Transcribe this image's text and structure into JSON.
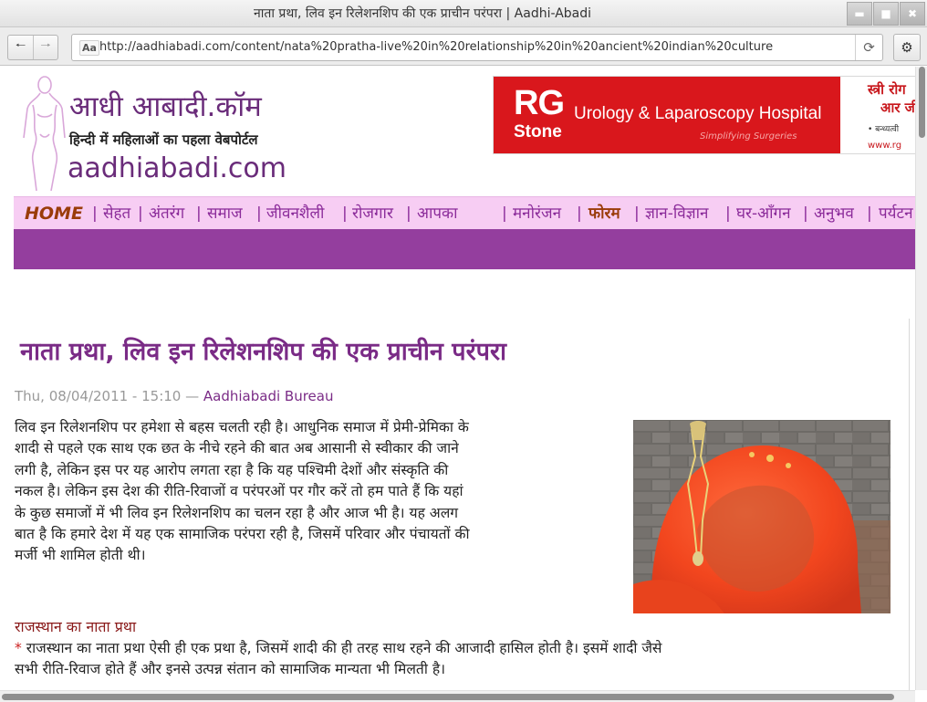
{
  "window": {
    "title": "नाता प्रथा, लिव इन रिलेशनशिप की एक प्राचीन परंपरा | Aadhi-Abadi"
  },
  "browser": {
    "url": "http://aadhiabadi.com/content/nata%20pratha-live%20in%20relationship%20in%20ancient%20indian%20culture",
    "site_icon_text": "Aa"
  },
  "header": {
    "logo_hindi": "आधी आबादी.कॉम",
    "logo_tagline": "हिन्दी में महिलाओं का पहला वेबपोर्टल",
    "logo_english": "aadhiabadi.com"
  },
  "ad": {
    "brand": "RG",
    "brand_sub": "Stone",
    "hospital": "Urology & Laparoscopy Hospital",
    "tagline": "Simplifying Surgeries",
    "right_line1": "स्त्री रोग",
    "right_line2": "आर जी",
    "right_line3": "• बन्ध्यत्वी",
    "right_line4": "www.rg"
  },
  "nav": {
    "items": [
      {
        "label": "HOME"
      },
      {
        "label": "सेहत"
      },
      {
        "label": "अंतरंग"
      },
      {
        "label": "समाज"
      },
      {
        "label": "जीवनशैली"
      },
      {
        "label": "रोजगार"
      },
      {
        "label": "आपका"
      },
      {
        "label": "मनोरंजन"
      },
      {
        "label": "फोरम"
      },
      {
        "label": "ज्ञान-विज्ञान"
      },
      {
        "label": "घर-आँगन"
      },
      {
        "label": "अनुभव"
      },
      {
        "label": "पर्यटन"
      }
    ],
    "separator": "|"
  },
  "article": {
    "title": "नाता प्रथा, लिव इन रिलेशनशिप की एक प्राचीन परंपरा",
    "date": "Thu, 08/04/2011 - 15:10",
    "dash": "—",
    "author": "Aadhiabadi Bureau",
    "paragraph1_lines": [
      "लिव इन रिलेशनशिप पर हमेशा से बहस चलती रही है। आधुनिक समाज में प्रेमी-प्रेमिका के",
      "शादी से पहले एक साथ एक छत के नीचे रहने की बात अब आसानी से स्वीकार की जाने",
      "लगी है, लेकिन इस पर यह आरोप लगता रहा है कि यह पश्चिमी देशों और संस्कृति की",
      "नकल है। लेकिन इस देश की रीति-रिवाजों व परंपरओं पर गौर करें तो हम पाते हैं कि यहां",
      "के कुछ समाजों में भी लिव इन रिलेशनशिप का चलन रहा है और आज भी है। यह अलग",
      "बात है कि हमारे देश में यह एक सामाजिक परंपरा रही है, जिसमें परिवार और पंचायतों की",
      "मर्जी भी शामिल होती थी।"
    ],
    "subhead": "राजस्थान का नाता प्रथा",
    "bullet": "*",
    "paragraph2_lines": [
      "राजस्थान का नाता प्रथा ऐसी ही एक प्रथा है, जिसमें शादी की ही तरह साथ रहने की आजादी हासिल होती है। इसमें शादी जैसे",
      "सभी रीति-रिवाज होते हैं और इनसे उत्पन्न संतान को सामाजिक मान्यता भी मिलती है।"
    ]
  },
  "colors": {
    "brand_purple": "#7a2b86",
    "nav_pink": "#f7cdf3",
    "nav_strip": "#943e9e",
    "ad_red": "#d9171c"
  }
}
